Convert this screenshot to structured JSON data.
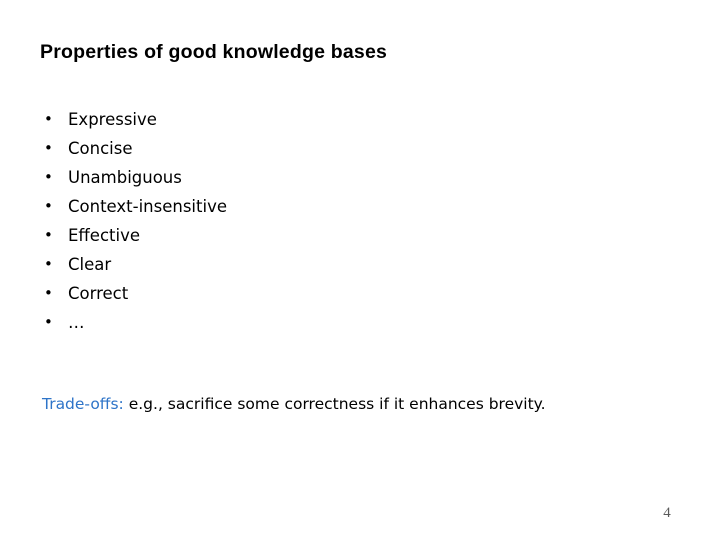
{
  "slide": {
    "title": "Properties of good knowledge bases",
    "bullet_marker": "•",
    "items": [
      {
        "label": "Expressive"
      },
      {
        "label": "Concise"
      },
      {
        "label": "Unambiguous"
      },
      {
        "label": "Context-insensitive"
      },
      {
        "label": "Effective"
      },
      {
        "label": "Clear"
      },
      {
        "label": "Correct"
      },
      {
        "label": "…"
      }
    ],
    "tradeoffs": {
      "label": "Trade-offs:",
      "body": "e.g., sacrifice some correctness if it enhances brevity.",
      "label_color": "#2E74C8"
    },
    "page_number": "4",
    "background_color": "#FFFFFF",
    "text_color": "#000000",
    "page_number_color": "#5A5A5A"
  }
}
